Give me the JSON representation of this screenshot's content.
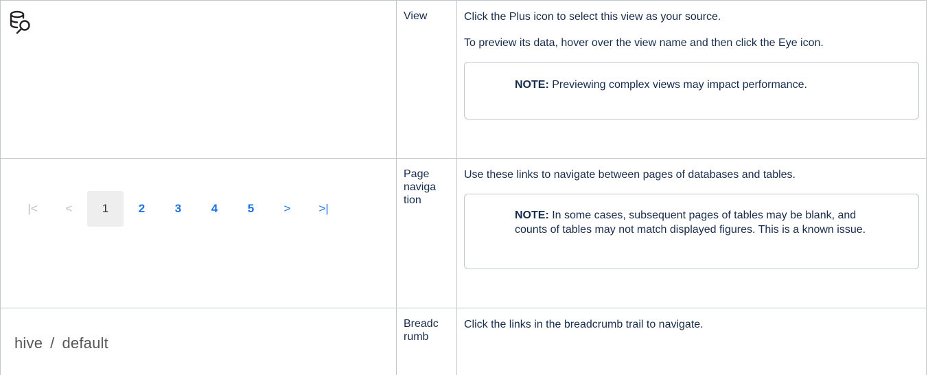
{
  "rows": [
    {
      "element": "View",
      "icon": "database-search-icon",
      "desc_lines": [
        "Click the Plus icon to select this view as your source.",
        "To preview its data, hover over the view name and then click the Eye icon."
      ],
      "note_label": "NOTE:",
      "note_text": "Previewing complex views may impact performance."
    },
    {
      "element": "Page naviga tion",
      "pagination": {
        "first": "|<",
        "prev": "<",
        "pages": [
          "1",
          "2",
          "3",
          "4",
          "5"
        ],
        "active_page": "1",
        "next": ">",
        "last": ">|"
      },
      "desc_lines": [
        "Use these links to navigate between pages of databases and tables."
      ],
      "note_label": "NOTE:",
      "note_text": "In some cases, subsequent pages of tables may be blank, and counts of tables may not match displayed figures. This is a known issue."
    },
    {
      "element": "Breadc rumb",
      "breadcrumb": [
        "hive",
        "default"
      ],
      "breadcrumb_separator": "/",
      "desc_lines": [
        "Click the links in the breadcrumb trail to navigate."
      ]
    }
  ]
}
